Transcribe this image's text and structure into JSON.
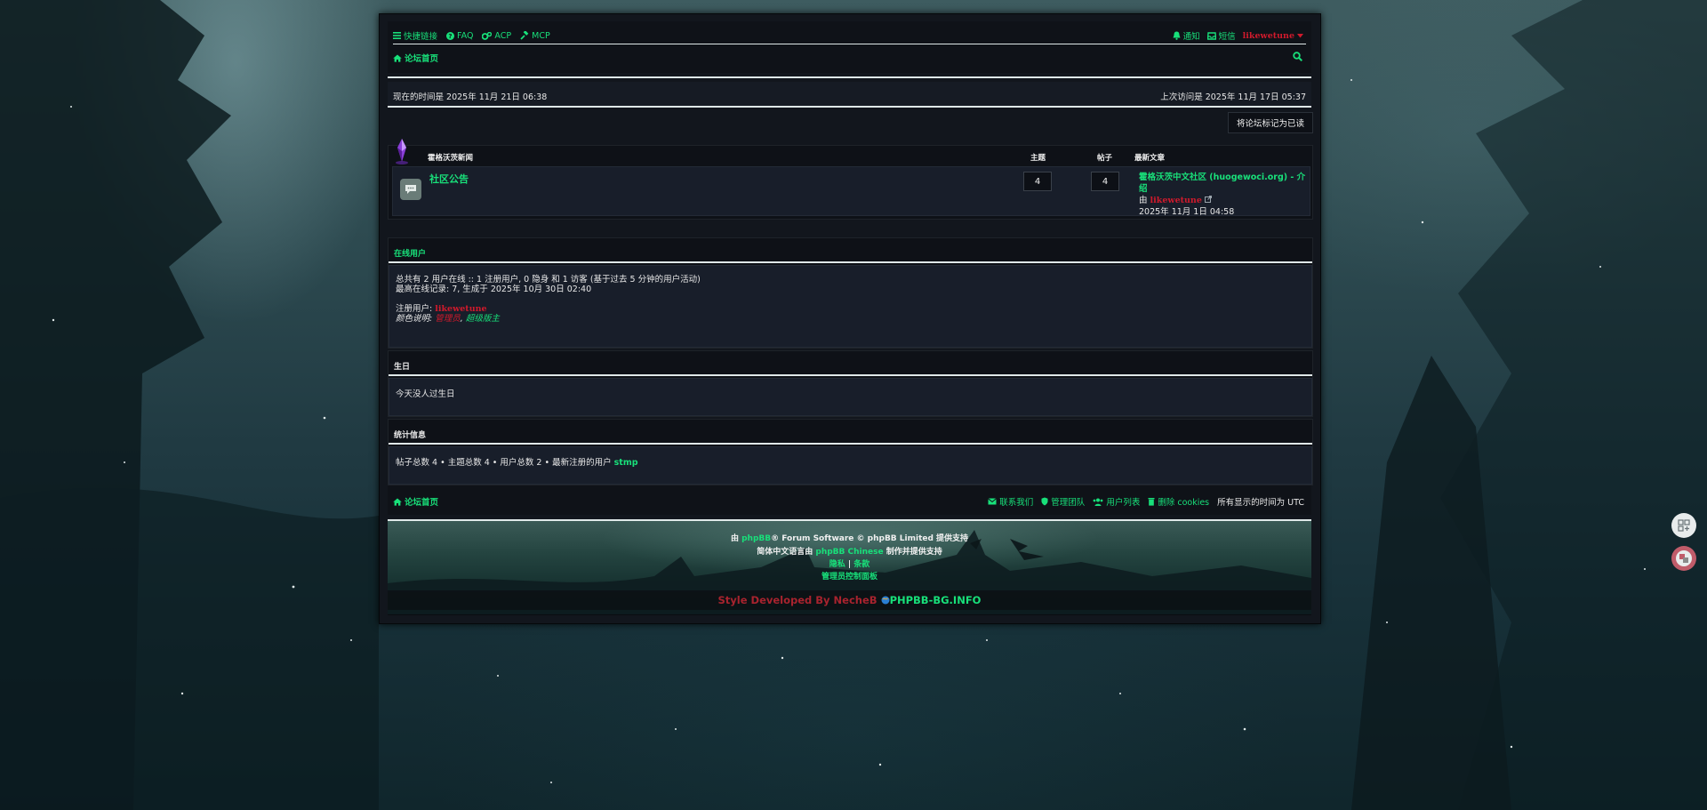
{
  "topbar": {
    "quicklinks": "快捷链接",
    "faq": "FAQ",
    "acp": "ACP",
    "mcp": "MCP",
    "notifications": "通知",
    "messages": "短信",
    "username": "likewetune",
    "breadcrumb": "论坛首页"
  },
  "timebar": {
    "current": "现在的时间是 2025年 11月 21日 06:38",
    "last_visit": "上次访问是 2025年 11月 17日 05:37"
  },
  "mark_read": "将论坛标记为已读",
  "forum": {
    "category": "霍格沃茨新闻",
    "col_topics": "主题",
    "col_posts": "帖子",
    "col_lastpost": "最新文章",
    "name": "社区公告",
    "topics": "4",
    "posts": "4",
    "lastpost_title": "霍格沃茨中文社区 (huogewoci.org) - 介绍",
    "lastpost_by": "由",
    "lastpost_user": "likewetune",
    "lastpost_date": "2025年 11月 1日 04:58"
  },
  "online": {
    "title": "在线用户",
    "line1": "总共有 2 用户在线 :: 1 注册用户, 0 隐身 和 1 访客 (基于过去 5 分钟的用户活动)",
    "line2": "最高在线记录: 7, 生成于 2025年 10月 30日 02:40",
    "registered_label": "注册用户:",
    "registered_user": "likewetune",
    "legend_label": "颜色说明:",
    "legend_admin": "管理员",
    "legend_mod": "超级版主",
    "legend_sep": ","
  },
  "birthdays": {
    "title": "生日",
    "text": "今天没人过生日"
  },
  "stats": {
    "title": "统计信息",
    "text": "帖子总数 4 • 主题总数 4 • 用户总数 2 • 最新注册的用户",
    "newest_user": "stmp"
  },
  "footer": {
    "home": "论坛首页",
    "contact": "联系我们",
    "team": "管理团队",
    "members": "用户列表",
    "delete_cookies": "删除 cookies",
    "timezone": "所有显示的时间为 UTC"
  },
  "credits": {
    "powered_prefix": "由",
    "phpbb": "phpBB",
    "powered_suffix": "® Forum Software © phpBB Limited 提供支持",
    "translation_prefix": "简体中文语言由",
    "translation_link": "phpBB Chinese",
    "translation_suffix": "制作并提供支持",
    "privacy": "隐私",
    "sep": "|",
    "terms": "条款",
    "acp_link": "管理员控制面板",
    "style_by": "Style Developed By NecheB",
    "site": "PHPBB-BG.INFO"
  },
  "colors": {
    "link": "#18e07a",
    "admin": "#d01a2c",
    "panel": "#0e1117"
  }
}
